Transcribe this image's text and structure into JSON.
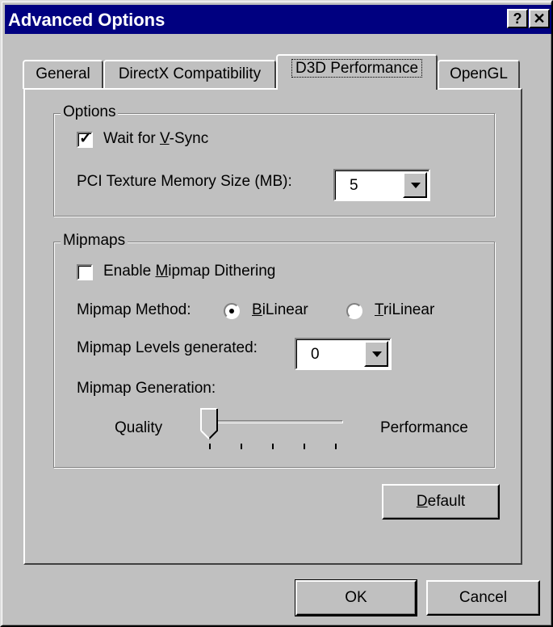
{
  "window": {
    "title": "Advanced Options",
    "help_label": "?",
    "close_label": "✕"
  },
  "tabs": [
    {
      "label": "General"
    },
    {
      "label": "DirectX Compatibility"
    },
    {
      "label": "D3D Performance"
    },
    {
      "label": "OpenGL"
    }
  ],
  "options_group": {
    "legend": "Options",
    "vsync": {
      "pre": "Wait for ",
      "accel": "V",
      "post": "-Sync",
      "checked": true
    },
    "pci_label": "PCI Texture Memory Size (MB):",
    "pci_value": "5"
  },
  "mipmaps_group": {
    "legend": "Mipmaps",
    "dither": {
      "pre": "Enable ",
      "accel": "M",
      "post": "ipmap Dithering",
      "checked": false
    },
    "method_label": "Mipmap Method:",
    "bilinear": {
      "accel": "B",
      "post": "iLinear",
      "selected": true
    },
    "trilinear": {
      "accel": "T",
      "post": "riLinear",
      "selected": false
    },
    "levels_label": "Mipmap Levels generated:",
    "levels_value": "0",
    "generation_label": "Mipmap Generation:",
    "slider_min_label": "Quality",
    "slider_max_label": "Performance",
    "slider_position": 0,
    "slider_ticks": 5
  },
  "buttons": {
    "default": {
      "accel": "D",
      "post": "efault"
    },
    "ok": "OK",
    "cancel": "Cancel"
  }
}
